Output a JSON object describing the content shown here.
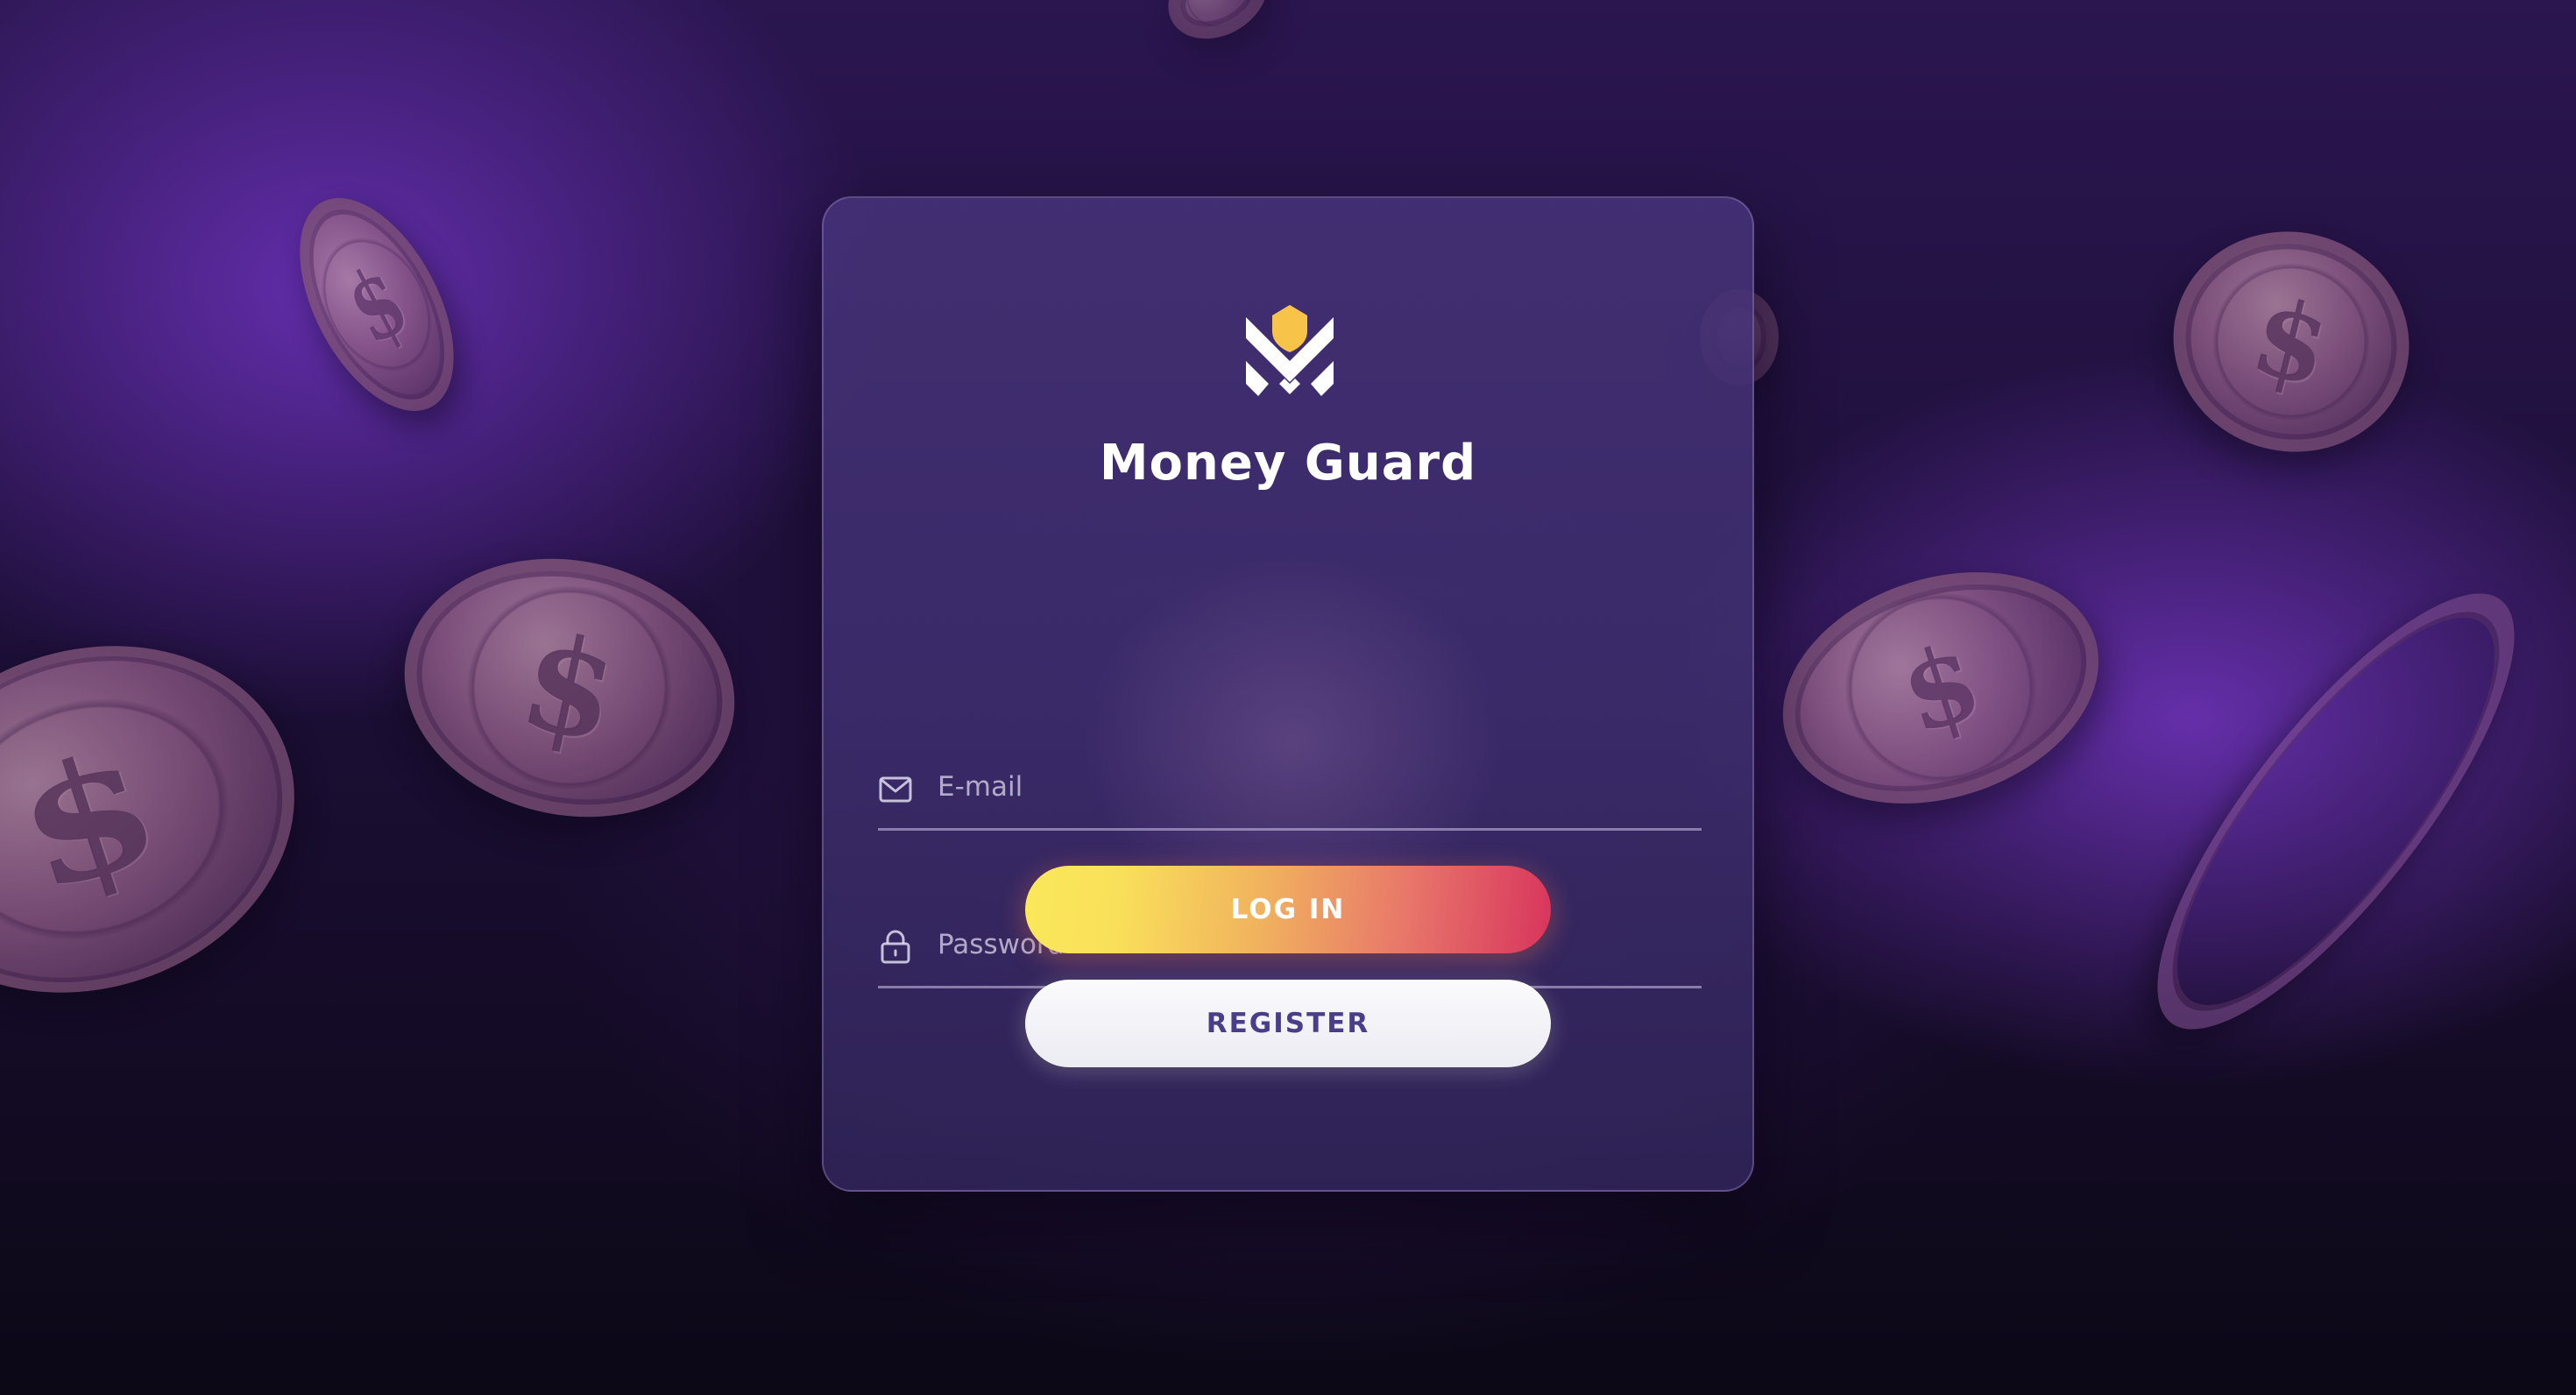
{
  "app": {
    "title": "Money Guard"
  },
  "logo": {
    "icon": "money-guard-logo-icon",
    "colors": {
      "shield": "#f7c348",
      "mark": "#ffffff"
    }
  },
  "form": {
    "email": {
      "icon": "mail-icon",
      "placeholder": "E-mail",
      "value": ""
    },
    "password": {
      "icon": "lock-icon",
      "placeholder": "Password",
      "value": ""
    }
  },
  "buttons": {
    "login_label": "LOG IN",
    "register_label": "REGISTER"
  },
  "colors": {
    "accent_start": "#fbe85a",
    "accent_end": "#d8345d",
    "register_text": "#4a3d8a",
    "background": "#1d0f38"
  }
}
